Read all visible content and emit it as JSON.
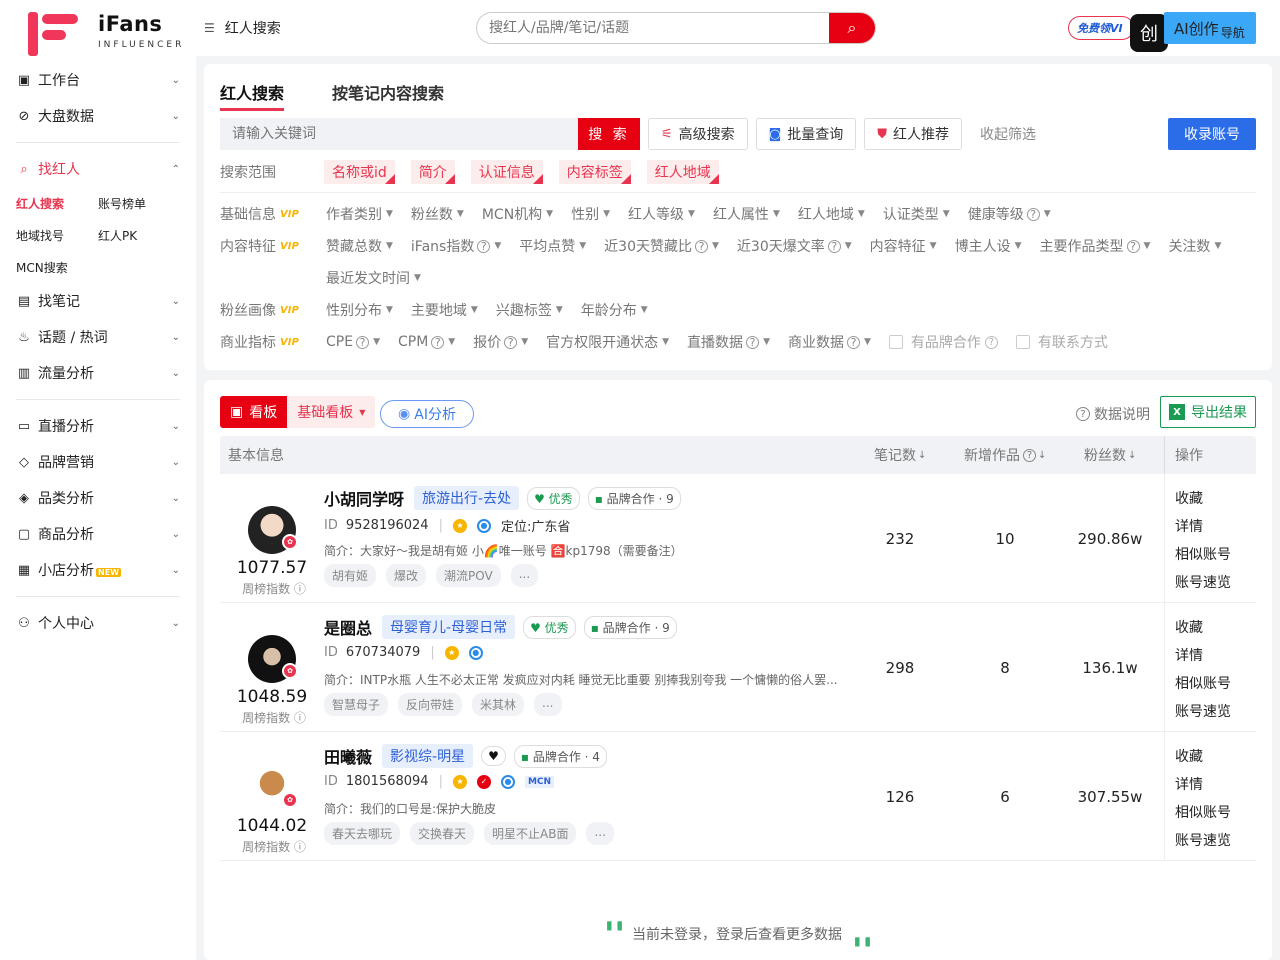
{
  "brand": {
    "name": "iFans",
    "sub": "INFLUENCER"
  },
  "sidebar": {
    "items": [
      {
        "label": "工作台",
        "icon": "dashboard-icon"
      },
      {
        "label": "大盘数据",
        "icon": "compass-icon"
      }
    ],
    "find_influencer": {
      "label": "找红人",
      "sub": [
        "红人搜索",
        "账号榜单",
        "地域找号",
        "红人PK",
        "MCN搜索"
      ]
    },
    "items2": [
      {
        "label": "找笔记"
      },
      {
        "label": "话题 / 热词"
      },
      {
        "label": "流量分析"
      }
    ],
    "items3": [
      {
        "label": "直播分析"
      },
      {
        "label": "品牌营销"
      },
      {
        "label": "品类分析"
      },
      {
        "label": "商品分析"
      },
      {
        "label": "小店分析",
        "badge": "NEW"
      }
    ],
    "personal": "个人中心"
  },
  "topbar": {
    "breadcrumb": "红人搜索",
    "search_placeholder": "搜红人/品牌/笔记/话题",
    "vip_promo": "免费领VI",
    "ai_create": "AI创作",
    "nav_small": "导航"
  },
  "filter": {
    "tabs": [
      "红人搜索",
      "按笔记内容搜索"
    ],
    "keyword_placeholder": "请输入关键词",
    "search_btn": "搜 索",
    "advanced": "高级搜索",
    "batch": "批量查询",
    "recommend": "红人推荐",
    "collapse": "收起筛选",
    "add_account": "收录账号",
    "scope_label": "搜索范围",
    "scope_tags": [
      "名称或id",
      "简介",
      "认证信息",
      "内容标签",
      "红人地域"
    ],
    "rows": {
      "basic": {
        "label": "基础信息",
        "items": [
          "作者类别",
          "粉丝数",
          "MCN机构",
          "性别",
          "红人等级",
          "红人属性",
          "红人地域",
          "认证类型",
          "健康等级"
        ]
      },
      "content": {
        "label": "内容特征",
        "items": [
          "赞藏总数",
          "iFans指数",
          "平均点赞",
          "近30天赞藏比",
          "近30天爆文率",
          "内容特征",
          "博主人设",
          "主要作品类型",
          "关注数"
        ],
        "extra": "最近发文时间"
      },
      "fans": {
        "label": "粉丝画像",
        "items": [
          "性别分布",
          "主要地域",
          "兴趣标签",
          "年龄分布"
        ]
      },
      "business": {
        "label": "商业指标",
        "items": [
          "CPE",
          "CPM",
          "报价",
          "官方权限开通状态",
          "直播数据",
          "商业数据"
        ],
        "checks": [
          "有品牌合作",
          "有联系方式"
        ]
      }
    },
    "vip": "VIP"
  },
  "results": {
    "board_left": "看板",
    "board_right": "基础看板",
    "ai_analyze": "AI分析",
    "data_help": "数据说明",
    "export": "导出结果",
    "columns": {
      "basic": "基本信息",
      "notes": "笔记数",
      "new_works": "新增作品",
      "fans": "粉丝数",
      "op": "操作"
    },
    "ops": [
      "收藏",
      "详情",
      "相似账号",
      "账号速览"
    ],
    "score_label": "周榜指数",
    "id_label": "ID",
    "rows": [
      {
        "name": "小胡同学呀",
        "category": "旅游出行-去处",
        "quality": "优秀",
        "coop": "品牌合作 · 9",
        "id": "9528196024",
        "location": "定位:广东省",
        "intro": "简介：大家好～我是胡有姬 小🌈唯一账号 🈴kp1798（需要备注）",
        "tags": [
          "胡有姬",
          "爆改",
          "潮流POV",
          "..."
        ],
        "score": "1077.57",
        "notes": "232",
        "new_works": "10",
        "fans": "290.86w"
      },
      {
        "name": "是圈总",
        "category": "母婴育儿-母婴日常",
        "quality": "优秀",
        "coop": "品牌合作 · 9",
        "id": "670734079",
        "location": "",
        "intro": "简介：INTP水瓶 人生不必太正常 发疯应对内耗 睡觉无比重要 别捧我别夸我 一个慵懒的俗人罢...",
        "tags": [
          "智慧母子",
          "反向带娃",
          "米其林",
          "..."
        ],
        "score": "1048.59",
        "notes": "298",
        "new_works": "8",
        "fans": "136.1w"
      },
      {
        "name": "田曦薇",
        "category": "影视综-明星",
        "quality": "",
        "coop": "品牌合作 · 4",
        "id": "1801568094",
        "location": "",
        "mcn": "MCN",
        "intro": "简介：我们的口号是:保护大脆皮",
        "tags": [
          "春天去哪玩",
          "交换春天",
          "明星不止AB面",
          "..."
        ],
        "score": "1044.02",
        "notes": "126",
        "new_works": "6",
        "fans": "307.55w"
      }
    ],
    "login_tip": "当前未登录，登录后查看更多数据"
  }
}
